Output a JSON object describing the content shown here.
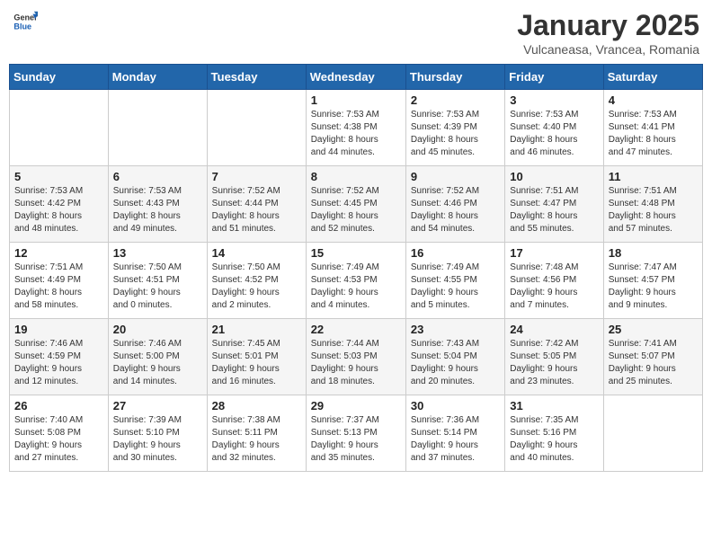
{
  "header": {
    "logo_general": "General",
    "logo_blue": "Blue",
    "title": "January 2025",
    "subtitle": "Vulcaneasa, Vrancea, Romania"
  },
  "weekdays": [
    "Sunday",
    "Monday",
    "Tuesday",
    "Wednesday",
    "Thursday",
    "Friday",
    "Saturday"
  ],
  "weeks": [
    [
      {
        "day": "",
        "info": ""
      },
      {
        "day": "",
        "info": ""
      },
      {
        "day": "",
        "info": ""
      },
      {
        "day": "1",
        "info": "Sunrise: 7:53 AM\nSunset: 4:38 PM\nDaylight: 8 hours\nand 44 minutes."
      },
      {
        "day": "2",
        "info": "Sunrise: 7:53 AM\nSunset: 4:39 PM\nDaylight: 8 hours\nand 45 minutes."
      },
      {
        "day": "3",
        "info": "Sunrise: 7:53 AM\nSunset: 4:40 PM\nDaylight: 8 hours\nand 46 minutes."
      },
      {
        "day": "4",
        "info": "Sunrise: 7:53 AM\nSunset: 4:41 PM\nDaylight: 8 hours\nand 47 minutes."
      }
    ],
    [
      {
        "day": "5",
        "info": "Sunrise: 7:53 AM\nSunset: 4:42 PM\nDaylight: 8 hours\nand 48 minutes."
      },
      {
        "day": "6",
        "info": "Sunrise: 7:53 AM\nSunset: 4:43 PM\nDaylight: 8 hours\nand 49 minutes."
      },
      {
        "day": "7",
        "info": "Sunrise: 7:52 AM\nSunset: 4:44 PM\nDaylight: 8 hours\nand 51 minutes."
      },
      {
        "day": "8",
        "info": "Sunrise: 7:52 AM\nSunset: 4:45 PM\nDaylight: 8 hours\nand 52 minutes."
      },
      {
        "day": "9",
        "info": "Sunrise: 7:52 AM\nSunset: 4:46 PM\nDaylight: 8 hours\nand 54 minutes."
      },
      {
        "day": "10",
        "info": "Sunrise: 7:51 AM\nSunset: 4:47 PM\nDaylight: 8 hours\nand 55 minutes."
      },
      {
        "day": "11",
        "info": "Sunrise: 7:51 AM\nSunset: 4:48 PM\nDaylight: 8 hours\nand 57 minutes."
      }
    ],
    [
      {
        "day": "12",
        "info": "Sunrise: 7:51 AM\nSunset: 4:49 PM\nDaylight: 8 hours\nand 58 minutes."
      },
      {
        "day": "13",
        "info": "Sunrise: 7:50 AM\nSunset: 4:51 PM\nDaylight: 9 hours\nand 0 minutes."
      },
      {
        "day": "14",
        "info": "Sunrise: 7:50 AM\nSunset: 4:52 PM\nDaylight: 9 hours\nand 2 minutes."
      },
      {
        "day": "15",
        "info": "Sunrise: 7:49 AM\nSunset: 4:53 PM\nDaylight: 9 hours\nand 4 minutes."
      },
      {
        "day": "16",
        "info": "Sunrise: 7:49 AM\nSunset: 4:55 PM\nDaylight: 9 hours\nand 5 minutes."
      },
      {
        "day": "17",
        "info": "Sunrise: 7:48 AM\nSunset: 4:56 PM\nDaylight: 9 hours\nand 7 minutes."
      },
      {
        "day": "18",
        "info": "Sunrise: 7:47 AM\nSunset: 4:57 PM\nDaylight: 9 hours\nand 9 minutes."
      }
    ],
    [
      {
        "day": "19",
        "info": "Sunrise: 7:46 AM\nSunset: 4:59 PM\nDaylight: 9 hours\nand 12 minutes."
      },
      {
        "day": "20",
        "info": "Sunrise: 7:46 AM\nSunset: 5:00 PM\nDaylight: 9 hours\nand 14 minutes."
      },
      {
        "day": "21",
        "info": "Sunrise: 7:45 AM\nSunset: 5:01 PM\nDaylight: 9 hours\nand 16 minutes."
      },
      {
        "day": "22",
        "info": "Sunrise: 7:44 AM\nSunset: 5:03 PM\nDaylight: 9 hours\nand 18 minutes."
      },
      {
        "day": "23",
        "info": "Sunrise: 7:43 AM\nSunset: 5:04 PM\nDaylight: 9 hours\nand 20 minutes."
      },
      {
        "day": "24",
        "info": "Sunrise: 7:42 AM\nSunset: 5:05 PM\nDaylight: 9 hours\nand 23 minutes."
      },
      {
        "day": "25",
        "info": "Sunrise: 7:41 AM\nSunset: 5:07 PM\nDaylight: 9 hours\nand 25 minutes."
      }
    ],
    [
      {
        "day": "26",
        "info": "Sunrise: 7:40 AM\nSunset: 5:08 PM\nDaylight: 9 hours\nand 27 minutes."
      },
      {
        "day": "27",
        "info": "Sunrise: 7:39 AM\nSunset: 5:10 PM\nDaylight: 9 hours\nand 30 minutes."
      },
      {
        "day": "28",
        "info": "Sunrise: 7:38 AM\nSunset: 5:11 PM\nDaylight: 9 hours\nand 32 minutes."
      },
      {
        "day": "29",
        "info": "Sunrise: 7:37 AM\nSunset: 5:13 PM\nDaylight: 9 hours\nand 35 minutes."
      },
      {
        "day": "30",
        "info": "Sunrise: 7:36 AM\nSunset: 5:14 PM\nDaylight: 9 hours\nand 37 minutes."
      },
      {
        "day": "31",
        "info": "Sunrise: 7:35 AM\nSunset: 5:16 PM\nDaylight: 9 hours\nand 40 minutes."
      },
      {
        "day": "",
        "info": ""
      }
    ]
  ]
}
